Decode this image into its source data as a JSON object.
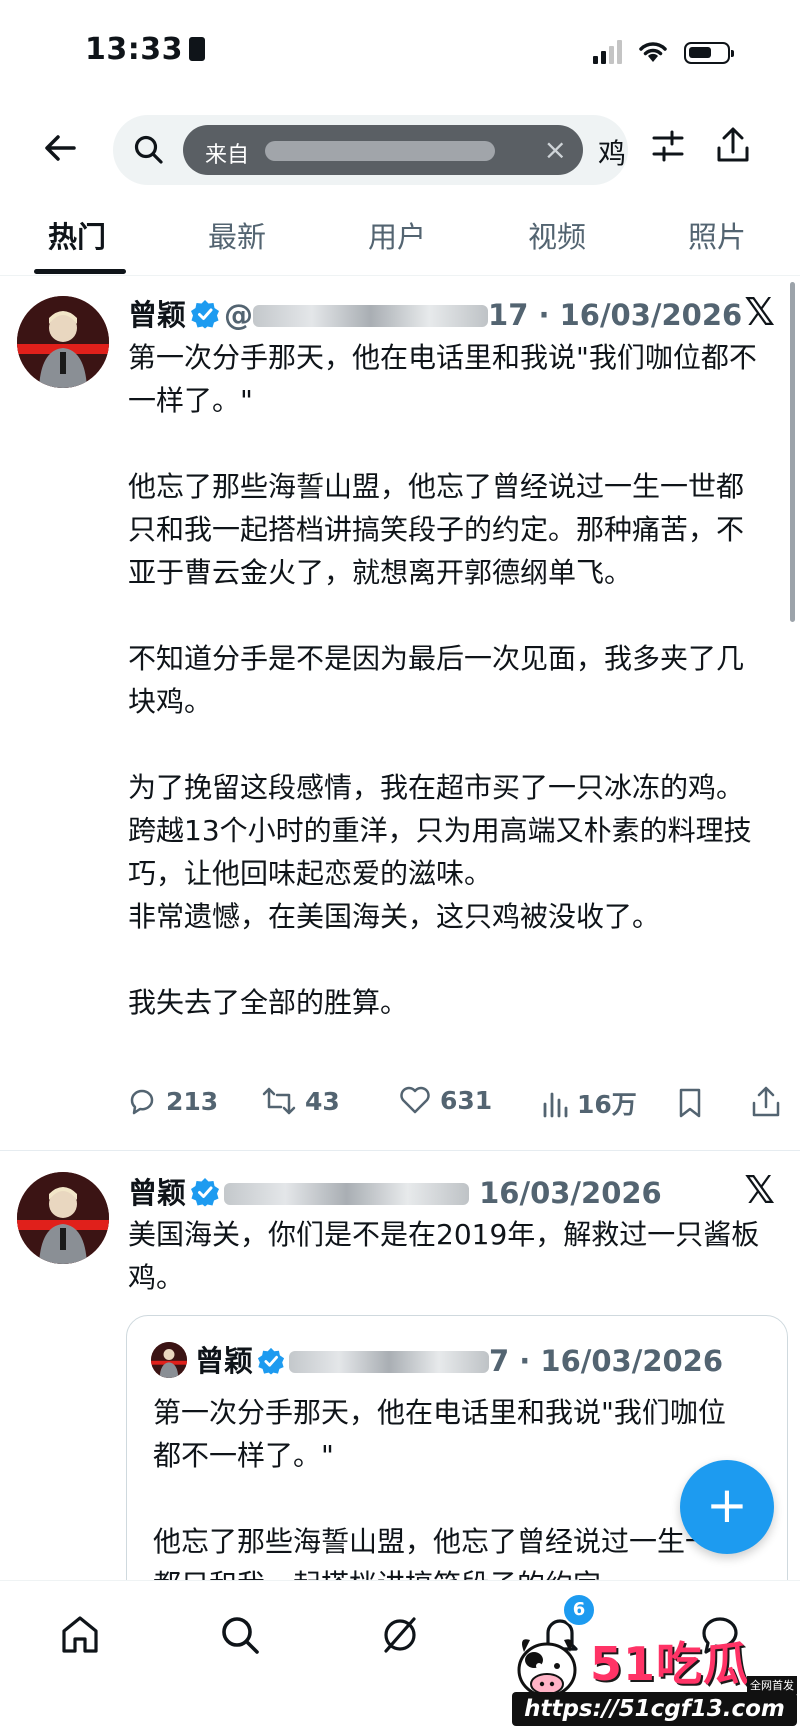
{
  "status_bar": {
    "time": "13:33"
  },
  "search": {
    "chip_text": "来自",
    "query": "鸡"
  },
  "tabs": [
    {
      "label": "热门",
      "active": true
    },
    {
      "label": "最新"
    },
    {
      "label": "用户"
    },
    {
      "label": "视频"
    },
    {
      "label": "照片"
    }
  ],
  "tweet1": {
    "name": "曾颖",
    "handle_suffix": "17",
    "date": "16/03/2026",
    "paragraphs": [
      "第一次分手那天，他在电话里和我说\"我们咖位都不一样了。\"",
      "他忘了那些海誓山盟，他忘了曾经说过一生一世都只和我一起搭档讲搞笑段子的约定。那种痛苦，不亚于曹云金火了，就想离开郭德纲单飞。",
      "不知道分手是不是因为最后一次见面，我多夹了几块鸡。",
      "为了挽留这段感情，我在超市买了一只冰冻的鸡。跨越13个小时的重洋，只为用高端又朴素的料理技巧，让他回味起恋爱的滋味。\n非常遗憾，在美国海关，这只鸡被没收了。",
      "我失去了全部的胜算。"
    ],
    "replies": "213",
    "retweets": "43",
    "likes": "631",
    "views": "16万"
  },
  "tweet2": {
    "name": "曾颖",
    "date": "16/03/2026",
    "text": "美国海关，你们是不是在2019年，解救过一只酱板鸡。"
  },
  "quote": {
    "name": "曾颖",
    "handle_suffix": "7",
    "date": "16/03/2026",
    "paragraphs": [
      "第一次分手那天，他在电话里和我说\"我们咖位都不一样了。\"",
      "他忘了那些海誓山盟，他忘了曾经说过一生一世都只和我一起搭档讲搞笑段子的约定"
    ]
  },
  "fab_label": "+",
  "bottom_nav": {
    "notifications_badge": "6",
    "icons": [
      "home-icon",
      "search-icon",
      "grok-icon",
      "bell-icon",
      "messages-icon"
    ]
  },
  "watermark": {
    "logo": "51吃瓜",
    "tag": "全网首发",
    "url": "https://51cgf13.com"
  },
  "colors": {
    "accent": "#1d9bf0",
    "text": "#0f1419",
    "muted": "#536471",
    "search_bg": "#eff3f4"
  }
}
